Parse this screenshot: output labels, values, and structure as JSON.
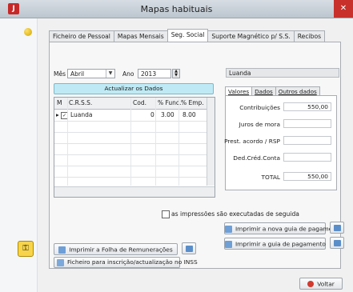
{
  "window": {
    "title": "Mapas habituais",
    "close_glyph": "✕",
    "app_icon_glyph": "J"
  },
  "tabs": [
    {
      "label": "Ficheiro de Pessoal",
      "active": false
    },
    {
      "label": "Mapas Mensais",
      "active": false
    },
    {
      "label": "Seg. Social",
      "active": true
    },
    {
      "label": "Suporte Magnético p/ S.S.",
      "active": false
    },
    {
      "label": "Recibos",
      "active": false
    }
  ],
  "filters": {
    "month_label": "Mês",
    "month_value": "Abril",
    "year_label": "Ano",
    "year_value": "2013",
    "update_button": "Actualizar os Dados"
  },
  "grid": {
    "headers": [
      "M",
      "C.R.S.S.",
      "Cod.",
      "% Func.",
      "% Emp."
    ],
    "rows": [
      {
        "checked": "✓",
        "crss": "Luanda",
        "cod": "0",
        "func": "3.00",
        "emp": "8.00"
      }
    ]
  },
  "detail": {
    "name": "Luanda",
    "tabs": [
      "Valores",
      "Dados",
      "Outros dados"
    ],
    "fields": [
      {
        "label": "Contribuições",
        "value": "550,00"
      },
      {
        "label": "Juros de mora",
        "value": ""
      },
      {
        "label": "Prest. acordo / RSP",
        "value": ""
      },
      {
        "label": "Ded.Créd.Conta",
        "value": ""
      },
      {
        "label": "TOTAL",
        "value": "550,00"
      }
    ]
  },
  "options": {
    "sequential_print_label": "as impressões são executadas de seguida"
  },
  "actions": {
    "print_new_guide": "Imprimir a nova guia de pagamento",
    "print_guide": "Imprimir a guia de pagamento",
    "print_payroll": "Imprimir a Folha de Remunerações",
    "inss_file": "Ficheiro para inscrição/actualização no INSS",
    "back": "Voltar"
  },
  "colors": {
    "accent_blue": "#5a8ec9",
    "close_red": "#c8302b",
    "update_button_bg": "#bfeaf5"
  },
  "icons": [
    "app-icon",
    "coin-icon",
    "folder-key-icon",
    "printer-icon",
    "cancel-icon"
  ]
}
